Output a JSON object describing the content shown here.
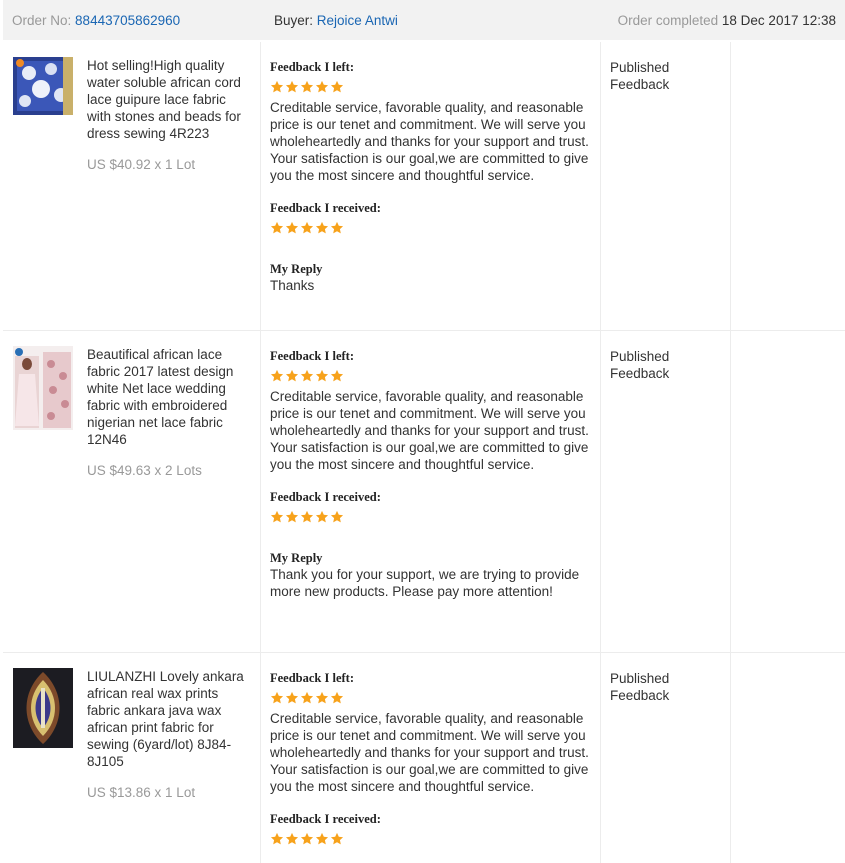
{
  "order": {
    "order_no_label": "Order No:",
    "order_no": "88443705862960",
    "buyer_label": "Buyer:",
    "buyer_name": "Rejoice Antwi",
    "completed_label": "Order completed",
    "completed_date": "18 Dec 2017 12:38"
  },
  "labels": {
    "feedback_left": "Feedback I left:",
    "feedback_received": "Feedback I received:",
    "my_reply": "My Reply"
  },
  "colors": {
    "accent_link": "#1a66b3",
    "star": "#f7a21b"
  },
  "items": [
    {
      "title": "Hot selling!High quality water soluble african cord lace guipure lace fabric with stones and beads for dress sewing 4R223",
      "price": "US $40.92 x 1 Lot",
      "thumb_icon": "blue-lace-fabric-thumbnail",
      "feedback_left_rating": 5,
      "feedback_left_text": "Creditable service, favorable quality, and reasonable price is our tenet and commitment. We will serve you wholeheartedly and thanks for your support and trust. Your satisfaction is our goal,we are committed to give you the most sincere and thoughtful service.",
      "feedback_received_rating": 5,
      "reply_text": "Thanks",
      "status": "Published Feedback"
    },
    {
      "title": "Beautifical african lace fabric 2017 latest design white Net lace wedding fabric with embroidered nigerian net lace fabric 12N46",
      "price": "US $49.63 x 2 Lots",
      "thumb_icon": "white-net-lace-thumbnail",
      "feedback_left_rating": 5,
      "feedback_left_text": "Creditable service, favorable quality, and reasonable price is our tenet and commitment. We will serve you wholeheartedly and thanks for your support and trust. Your satisfaction is our goal,we are committed to give you the most sincere and thoughtful service.",
      "feedback_received_rating": 5,
      "reply_text": "Thank you for your support, we are trying to provide more new products. Please pay more attention!",
      "status": "Published Feedback"
    },
    {
      "title": "LIULANZHI Lovely ankara african real wax prints fabric ankara java wax african print fabric for sewing (6yard/lot) 8J84-8J105",
      "price": "US $13.86 x 1 Lot",
      "thumb_icon": "ankara-wax-print-thumbnail",
      "feedback_left_rating": 5,
      "feedback_left_text": "Creditable service, favorable quality, and reasonable price is our tenet and commitment. We will serve you wholeheartedly and thanks for your support and trust. Your satisfaction is our goal,we are committed to give you the most sincere and thoughtful service.",
      "feedback_received_rating": 5,
      "status": "Published Feedback"
    }
  ]
}
